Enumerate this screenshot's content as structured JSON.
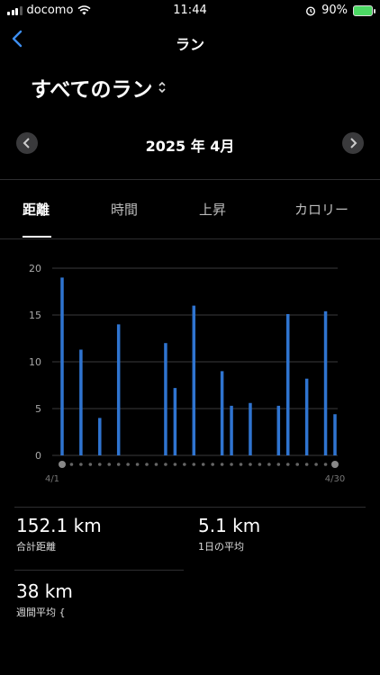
{
  "status_bar": {
    "carrier": "docomo",
    "time": "11:44",
    "battery": "90%"
  },
  "nav": {
    "title": "ラン"
  },
  "filter": {
    "label": "すべてのラン"
  },
  "month": {
    "label": "2025 年 4月"
  },
  "tabs": [
    {
      "label": "距離",
      "active": true
    },
    {
      "label": "時間",
      "active": false
    },
    {
      "label": "上昇",
      "active": false
    },
    {
      "label": "カロリー",
      "active": false
    }
  ],
  "chart_data": {
    "type": "bar",
    "x_start_label": "4/1",
    "x_end_label": "4/30",
    "ylim": [
      0,
      20
    ],
    "yticks": [
      0,
      5,
      10,
      15,
      20
    ],
    "color": "#2f74d0",
    "days": [
      1,
      2,
      3,
      4,
      5,
      6,
      7,
      8,
      9,
      10,
      11,
      12,
      13,
      14,
      15,
      16,
      17,
      18,
      19,
      20,
      21,
      22,
      23,
      24,
      25,
      26,
      27,
      28,
      29,
      30
    ],
    "values": [
      19.0,
      0,
      11.3,
      0,
      4.0,
      0,
      14.0,
      0,
      0,
      0,
      0,
      12.0,
      7.2,
      0,
      16.0,
      0,
      0,
      9.0,
      5.3,
      0,
      5.6,
      0,
      0,
      5.3,
      15.1,
      0,
      8.2,
      0,
      15.4,
      4.4
    ]
  },
  "stats": {
    "total": {
      "value": "152.1 km",
      "label": "合計距離"
    },
    "daily_avg": {
      "value": "5.1 km",
      "label": "1日の平均"
    },
    "weekly_avg": {
      "value": "38 km",
      "label": "週間平均 {"
    }
  }
}
